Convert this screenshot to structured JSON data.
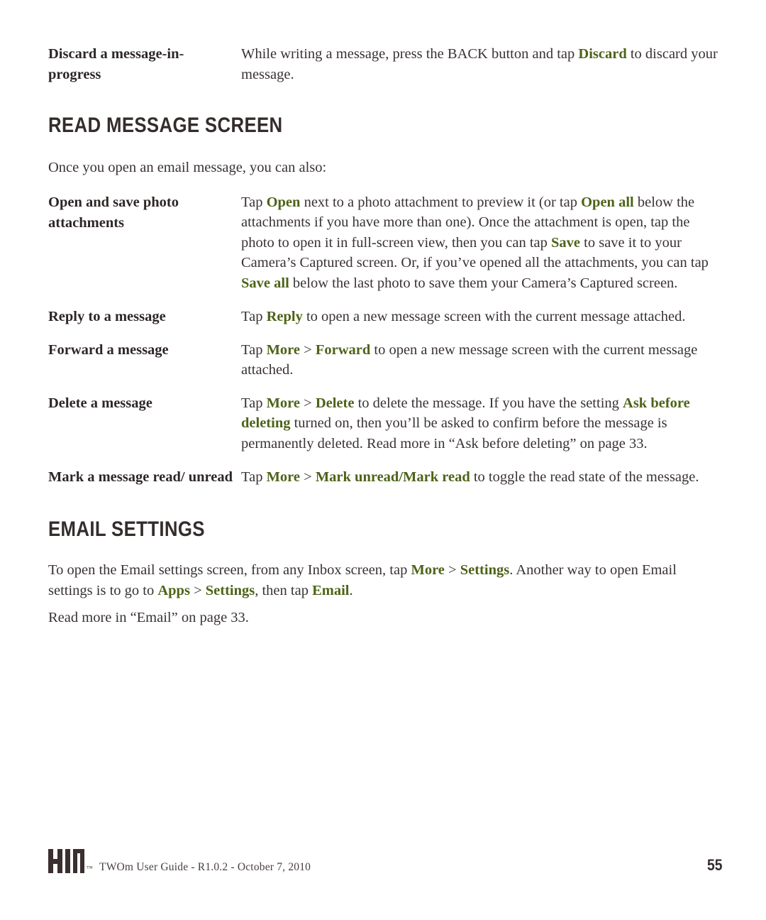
{
  "document": {
    "title": "KIN TWOm User Guide",
    "page_number": "55",
    "footer_text": "TWOm User Guide - R1.0.2 - October 7, 2010",
    "logo_text": "KIN",
    "logo_tm": "™"
  },
  "colors": {
    "ui_green": "#4d6318",
    "body_text": "#3a3232",
    "heading": "#352c2c",
    "page_background": "#ffffff"
  },
  "top_row": {
    "term": "Discard a message-in-progress",
    "desc": {
      "p1": "While writing a message, press the BACK button and tap ",
      "ui1": "Discard",
      "p2": " to discard your message."
    }
  },
  "sections": [
    {
      "heading": "READ MESSAGE SCREEN",
      "lead": "Once you open an email message, you can also:",
      "rows": [
        {
          "term": "Open and save photo attachments",
          "parts": [
            {
              "t": "Tap ",
              "style": "plain"
            },
            {
              "t": "Open",
              "style": "ui"
            },
            {
              "t": " next to a photo attachment to preview it (or tap ",
              "style": "plain"
            },
            {
              "t": "Open all",
              "style": "ui"
            },
            {
              "t": " below the attachments if you have more than one). Once the attachment is open, tap the photo to open it in full-screen view, then you can tap ",
              "style": "plain"
            },
            {
              "t": "Save",
              "style": "ui"
            },
            {
              "t": " to save it to your Camera’s Captured screen. Or, if you’ve opened all the attachments, you can tap ",
              "style": "plain"
            },
            {
              "t": "Save all",
              "style": "ui"
            },
            {
              "t": " below the last photo to save them your Camera’s Captured screen.",
              "style": "plain"
            }
          ]
        },
        {
          "term": "Reply to a message",
          "parts": [
            {
              "t": "Tap ",
              "style": "plain"
            },
            {
              "t": "Reply",
              "style": "ui"
            },
            {
              "t": " to open a new message screen with the current message attached.",
              "style": "plain"
            }
          ]
        },
        {
          "term": "Forward a message",
          "parts": [
            {
              "t": "Tap ",
              "style": "plain"
            },
            {
              "t": "More",
              "style": "ui"
            },
            {
              "t": " > ",
              "style": "sep"
            },
            {
              "t": "Forward",
              "style": "ui"
            },
            {
              "t": " to open a new message screen with the current message attached.",
              "style": "plain"
            }
          ]
        },
        {
          "term": "Delete a message",
          "parts": [
            {
              "t": "Tap ",
              "style": "plain"
            },
            {
              "t": "More",
              "style": "ui"
            },
            {
              "t": " > ",
              "style": "sep"
            },
            {
              "t": "Delete",
              "style": "ui"
            },
            {
              "t": " to delete the message. If you have the setting ",
              "style": "plain"
            },
            {
              "t": "Ask before deleting",
              "style": "ui"
            },
            {
              "t": " turned on, then you’ll be asked to confirm before the message is permanently deleted. Read more in “Ask before deleting” on page 33.",
              "style": "plain"
            }
          ]
        },
        {
          "term": "Mark a message read/ unread",
          "parts": [
            {
              "t": "Tap ",
              "style": "plain"
            },
            {
              "t": "More",
              "style": "ui"
            },
            {
              "t": " > ",
              "style": "sep"
            },
            {
              "t": "Mark unread/Mark read",
              "style": "ui"
            },
            {
              "t": " to toggle the read state of the message.",
              "style": "plain"
            }
          ]
        }
      ]
    },
    {
      "heading": "EMAIL SETTINGS",
      "paragraphs": [
        {
          "parts": [
            {
              "t": "To open the Email settings screen, from any Inbox screen, tap ",
              "style": "plain"
            },
            {
              "t": "More",
              "style": "ui"
            },
            {
              "t": " > ",
              "style": "sep"
            },
            {
              "t": "Settings",
              "style": "ui"
            },
            {
              "t": ". Another way to open Email settings is to go to ",
              "style": "plain"
            },
            {
              "t": "Apps",
              "style": "ui"
            },
            {
              "t": " > ",
              "style": "sep"
            },
            {
              "t": "Settings",
              "style": "ui"
            },
            {
              "t": ", then tap ",
              "style": "plain"
            },
            {
              "t": "Email",
              "style": "ui"
            },
            {
              "t": ".",
              "style": "plain"
            }
          ]
        },
        {
          "parts": [
            {
              "t": "Read more in “Email” on page 33.",
              "style": "plain"
            }
          ]
        }
      ]
    }
  ]
}
